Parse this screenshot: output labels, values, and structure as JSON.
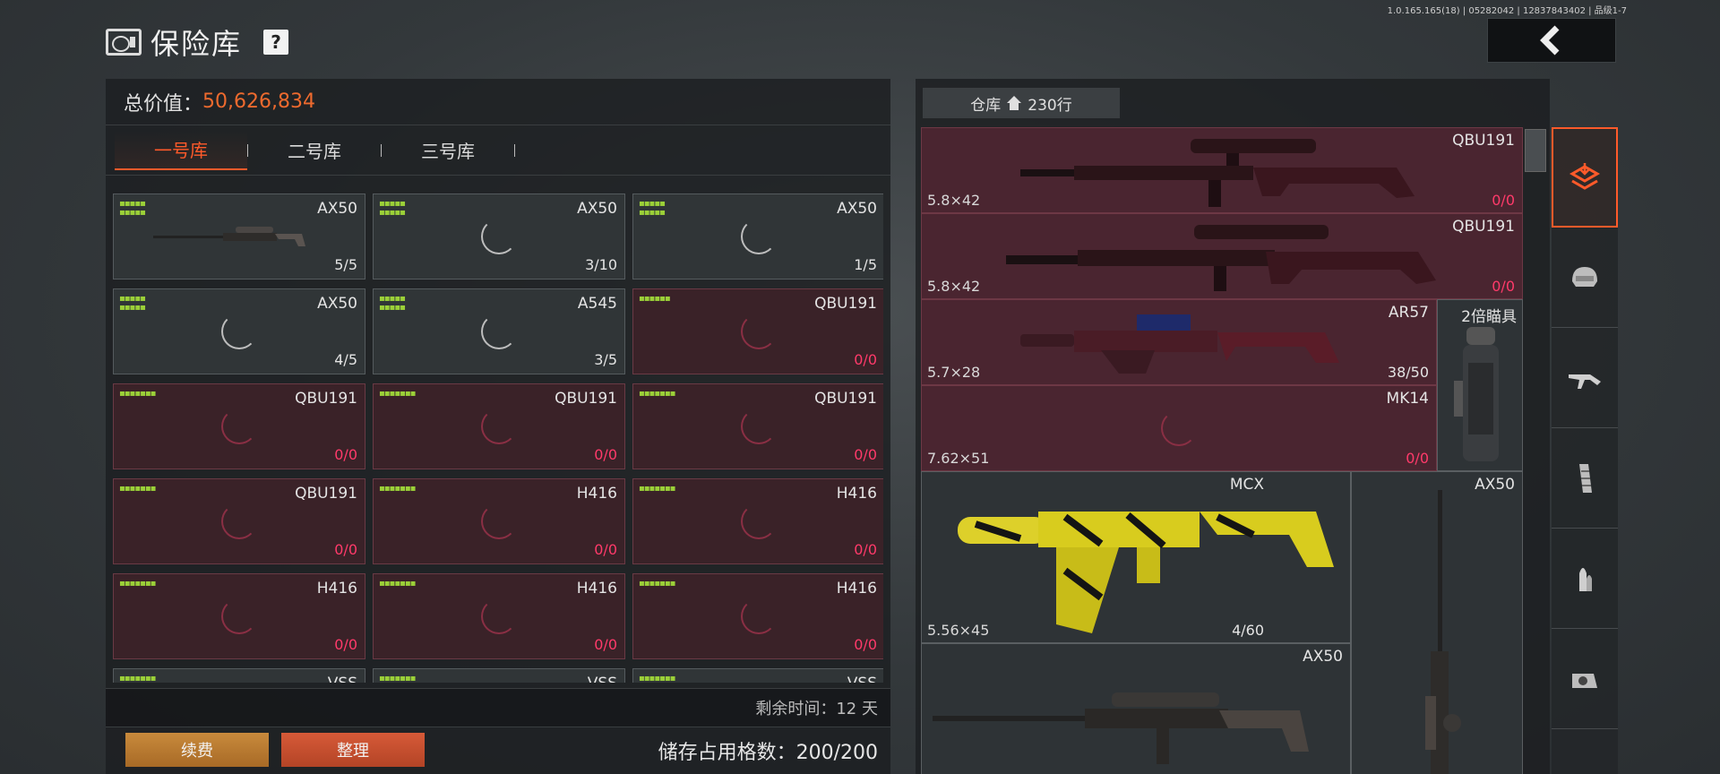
{
  "version": "1.0.165.165(18) | 05282042 | 12837843402 | 品级1-7",
  "header": {
    "title": "保险库",
    "help": "?",
    "back_glyph": "‹"
  },
  "left": {
    "total_label": "总价值：",
    "total_value": "50,626,834",
    "tabs": [
      "一号库",
      "二号库",
      "三号库"
    ],
    "active_tab": 0,
    "cells": [
      {
        "name": "AX50",
        "count": "5/5",
        "pips": "▪▪▪▪▪\n▪▪▪▪▪",
        "red": false,
        "gun": true
      },
      {
        "name": "AX50",
        "count": "3/10",
        "pips": "▪▪▪▪▪\n▪▪▪▪▪",
        "red": false
      },
      {
        "name": "AX50",
        "count": "1/5",
        "pips": "▪▪▪▪▪\n▪▪▪▪▪",
        "red": false
      },
      {
        "name": "AX50",
        "count": "4/5",
        "pips": "▪▪▪▪▪\n▪▪▪▪▪",
        "red": false
      },
      {
        "name": "A545",
        "count": "3/5",
        "pips": "▪▪▪▪▪\n▪▪▪▪▪",
        "red": false
      },
      {
        "name": "QBU191",
        "count": "0/0",
        "pips": "▪▪▪▪▪▪",
        "red": true
      },
      {
        "name": "QBU191",
        "count": "0/0",
        "pips": "▪▪▪▪▪▪▪",
        "red": true
      },
      {
        "name": "QBU191",
        "count": "0/0",
        "pips": "▪▪▪▪▪▪▪",
        "red": true
      },
      {
        "name": "QBU191",
        "count": "0/0",
        "pips": "▪▪▪▪▪▪▪",
        "red": true
      },
      {
        "name": "QBU191",
        "count": "0/0",
        "pips": "▪▪▪▪▪▪▪",
        "red": true
      },
      {
        "name": "H416",
        "count": "0/0",
        "pips": "▪▪▪▪▪▪▪",
        "red": true
      },
      {
        "name": "H416",
        "count": "0/0",
        "pips": "▪▪▪▪▪▪▪",
        "red": true
      },
      {
        "name": "H416",
        "count": "0/0",
        "pips": "▪▪▪▪▪▪▪",
        "red": true
      },
      {
        "name": "H416",
        "count": "0/0",
        "pips": "▪▪▪▪▪▪▪",
        "red": true
      },
      {
        "name": "H416",
        "count": "0/0",
        "pips": "▪▪▪▪▪▪▪",
        "red": true
      },
      {
        "name": "VSS",
        "count": "",
        "pips": "▪▪▪▪▪▪▪",
        "red": false
      },
      {
        "name": "VSS",
        "count": "",
        "pips": "▪▪▪▪▪▪▪",
        "red": false
      },
      {
        "name": "VSS",
        "count": "",
        "pips": "▪▪▪▪▪▪▪",
        "red": false
      }
    ],
    "remain_text": "剩余时间：12 天",
    "renew_label": "续费",
    "sort_label": "整理",
    "storage_text": "储存占用格数：200/200"
  },
  "right": {
    "warehouse_label": "仓库",
    "warehouse_count": "230行",
    "items": [
      {
        "name": "QBU191",
        "caliber": "5.8×42",
        "count": "0/0"
      },
      {
        "name": "QBU191",
        "caliber": "5.8×42",
        "count": "0/0"
      },
      {
        "name": "AR57",
        "caliber": "5.7×28",
        "count": "38/50"
      },
      {
        "name": "MK14",
        "caliber": "7.62×51",
        "count": "0/0"
      },
      {
        "name": "MCX",
        "caliber": "5.56×45",
        "count": "4/60"
      },
      {
        "name": "AX50",
        "caliber": "",
        "count": ""
      },
      {
        "name": "AX50",
        "caliber": "",
        "count": ""
      }
    ],
    "scope_label": "2倍瞄具"
  },
  "sidebar": [
    "stack-icon",
    "helmet-icon",
    "rifle-icon",
    "magazine-icon",
    "bullet-icon",
    "sight-icon"
  ],
  "colors": {
    "accent": "#ff5a2a",
    "value": "#ee6a2e",
    "pips": "#9bd038",
    "zero": "#ff3a6a"
  }
}
